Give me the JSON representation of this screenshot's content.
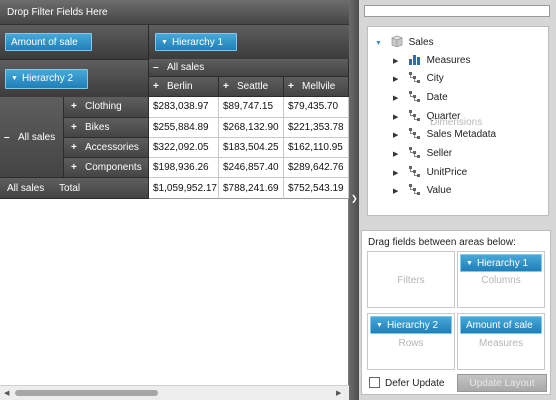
{
  "pivot": {
    "filter_zone_label": "Drop Filter Fields Here",
    "data_field": "Amount of sale",
    "column_field": "Hierarchy 1",
    "row_field": "Hierarchy 2",
    "column_root_label": "All sales",
    "columns": [
      "Berlin",
      "Seattle",
      "Mellvile"
    ],
    "row_group_label": "All sales",
    "rows": [
      {
        "label": "Clothing",
        "values": [
          "$283,038.97",
          "$89,747.15",
          "$79,435.70"
        ]
      },
      {
        "label": "Bikes",
        "values": [
          "$255,884.89",
          "$268,132.90",
          "$221,353.78"
        ]
      },
      {
        "label": "Accessories",
        "values": [
          "$322,092.05",
          "$183,504.25",
          "$162,110.95"
        ]
      },
      {
        "label": "Components",
        "values": [
          "$198,936.26",
          "$246,857.40",
          "$289,642.76"
        ]
      }
    ],
    "total_row": {
      "group": "All sales",
      "label": "Total",
      "values": [
        "$1,059,952.17",
        "$788,241.69",
        "$752,543.19"
      ]
    },
    "expand_symbol": "+",
    "collapse_symbol": "–"
  },
  "field_list": {
    "search_value": "",
    "tree": {
      "root": "Sales",
      "items": [
        {
          "label": "Measures",
          "icon": "measures-icon"
        },
        {
          "label": "City",
          "icon": "hierarchy-icon"
        },
        {
          "label": "Date",
          "icon": "hierarchy-icon"
        },
        {
          "label": "Quarter",
          "icon": "hierarchy-icon"
        },
        {
          "label": "Sales Metadata",
          "icon": "hierarchy-icon"
        },
        {
          "label": "Seller",
          "icon": "hierarchy-icon"
        },
        {
          "label": "UnitPrice",
          "icon": "hierarchy-icon"
        },
        {
          "label": "Value",
          "icon": "hierarchy-icon"
        }
      ],
      "ghost_label": "Dimensions"
    },
    "areas_title": "Drag fields between areas below:",
    "areas": {
      "filters": {
        "label": "Filters"
      },
      "columns": {
        "label": "Columns",
        "field": "Hierarchy 1"
      },
      "rows": {
        "label": "Rows",
        "field": "Hierarchy 2"
      },
      "measures": {
        "label": "Measures",
        "field": "Amount of sale"
      }
    },
    "defer_update_label": "Defer Update",
    "defer_update_checked": false,
    "update_layout_label": "Update Layout"
  },
  "colors": {
    "chip_blue": "#2f93cc",
    "header_dark": "#4f4f4f",
    "panel_gray": "#d6d6d6"
  }
}
